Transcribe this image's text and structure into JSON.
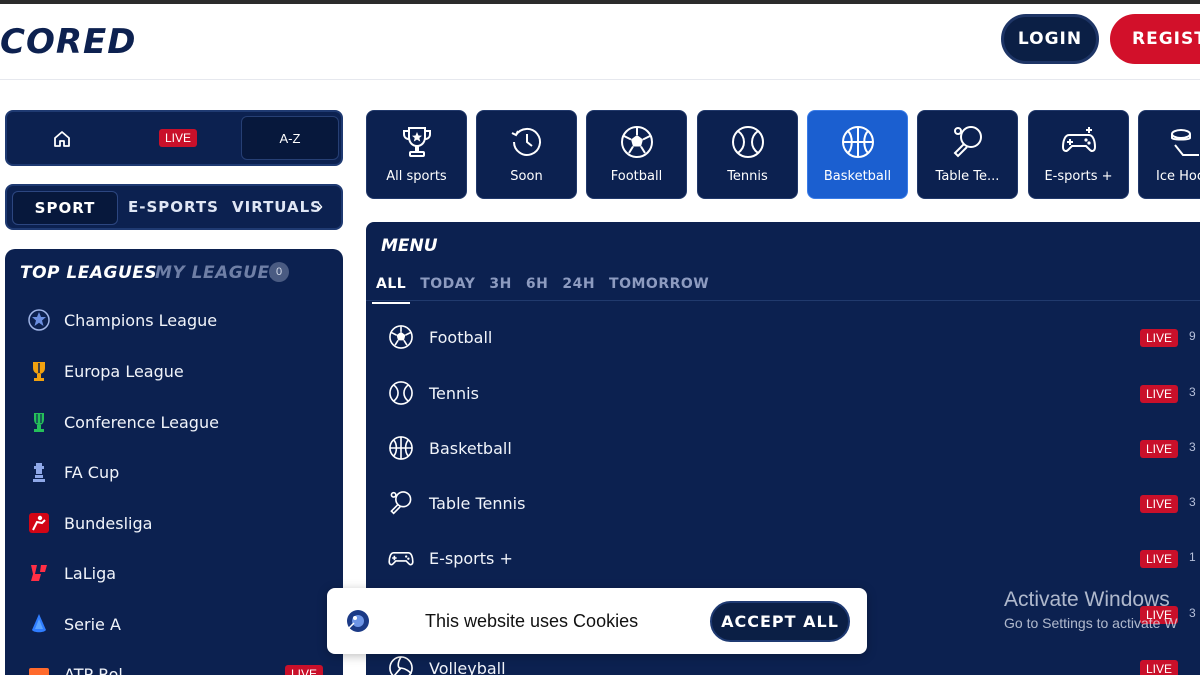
{
  "header": {
    "logo_text": "CORED",
    "login_label": "LOGIN",
    "register_label": "REGISTE"
  },
  "quick_nav": {
    "home_icon": "home-icon",
    "live_label": "LIVE",
    "az_label": "A-Z"
  },
  "sport_tabs": {
    "items": [
      "SPORT",
      "E-SPORTS",
      "VIRTUALS"
    ],
    "selected": "SPORT"
  },
  "leagues": {
    "top_label": "TOP LEAGUES",
    "my_label": "MY LEAGUES",
    "my_count": "0",
    "items": [
      {
        "name": "Champions League",
        "icon": "champions-league-icon"
      },
      {
        "name": "Europa League",
        "icon": "europa-league-icon"
      },
      {
        "name": "Conference League",
        "icon": "conference-league-icon"
      },
      {
        "name": "FA Cup",
        "icon": "fa-cup-icon"
      },
      {
        "name": "Bundesliga",
        "icon": "bundesliga-icon"
      },
      {
        "name": "LaLiga",
        "icon": "laliga-icon"
      },
      {
        "name": "Serie A",
        "icon": "serie-a-icon"
      },
      {
        "name": "ATP Rol",
        "icon": "atp-icon"
      }
    ],
    "live_label": "LIVE"
  },
  "categories": [
    {
      "label": "All sports",
      "icon": "trophy-icon"
    },
    {
      "label": "Soon",
      "icon": "clock-icon"
    },
    {
      "label": "Football",
      "icon": "football-icon"
    },
    {
      "label": "Tennis",
      "icon": "tennis-icon"
    },
    {
      "label": "Basketball",
      "icon": "basketball-icon",
      "active": true
    },
    {
      "label": "Table Te...",
      "icon": "table-tennis-icon"
    },
    {
      "label": "E-sports +",
      "icon": "gamepad-icon"
    },
    {
      "label": "Ice Hoc",
      "icon": "ice-hockey-icon"
    }
  ],
  "menu": {
    "title": "MENU",
    "filters": [
      "ALL",
      "TODAY",
      "3H",
      "6H",
      "24H",
      "TOMORROW"
    ],
    "active_filter": "ALL",
    "live_label": "LIVE",
    "sports": [
      {
        "name": "Football",
        "icon": "football-icon",
        "count": "9"
      },
      {
        "name": "Tennis",
        "icon": "tennis-icon",
        "count": "3"
      },
      {
        "name": "Basketball",
        "icon": "basketball-icon",
        "count": "3"
      },
      {
        "name": "Table Tennis",
        "icon": "table-tennis-icon",
        "count": "3"
      },
      {
        "name": "E-sports +",
        "icon": "gamepad-icon",
        "count": "1"
      },
      {
        "name": "",
        "icon": "",
        "count": "3"
      },
      {
        "name": "Volleyball",
        "icon": "volleyball-icon",
        "count": ""
      }
    ]
  },
  "cookie": {
    "text": "This website uses Cookies",
    "accept_label": "ACCEPT ALL"
  },
  "watermark": {
    "line1": "Activate Windows",
    "line2": "Go to Settings to activate W"
  },
  "colors": {
    "navy": "#0c2150",
    "dark_navy": "#07183c",
    "active_blue": "#1b5fd0",
    "live_red": "#c9102a",
    "register_red": "#d2102a"
  }
}
